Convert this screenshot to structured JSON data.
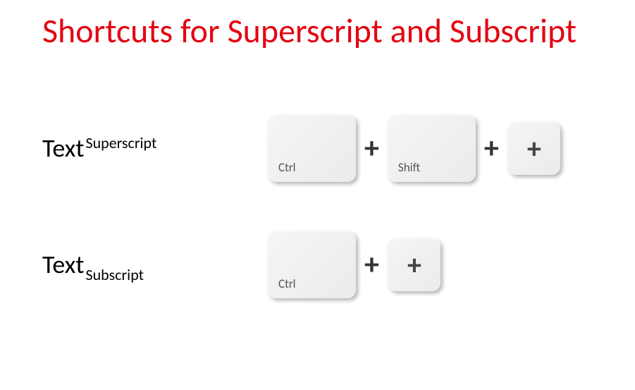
{
  "title": "Shortcuts for Superscript and Subscript",
  "rows": [
    {
      "label_base": "Text",
      "label_script": "Superscript",
      "keys": [
        {
          "label": "Ctrl",
          "type": "wide"
        },
        {
          "sep": "+"
        },
        {
          "label": "Shift",
          "type": "wide"
        },
        {
          "sep": "+"
        },
        {
          "glyph": "+",
          "type": "small"
        }
      ]
    },
    {
      "label_base": "Text",
      "label_script": "Subscript",
      "keys": [
        {
          "label": "Ctrl",
          "type": "wide"
        },
        {
          "sep": "+"
        },
        {
          "glyph": "+",
          "type": "small"
        }
      ]
    }
  ]
}
